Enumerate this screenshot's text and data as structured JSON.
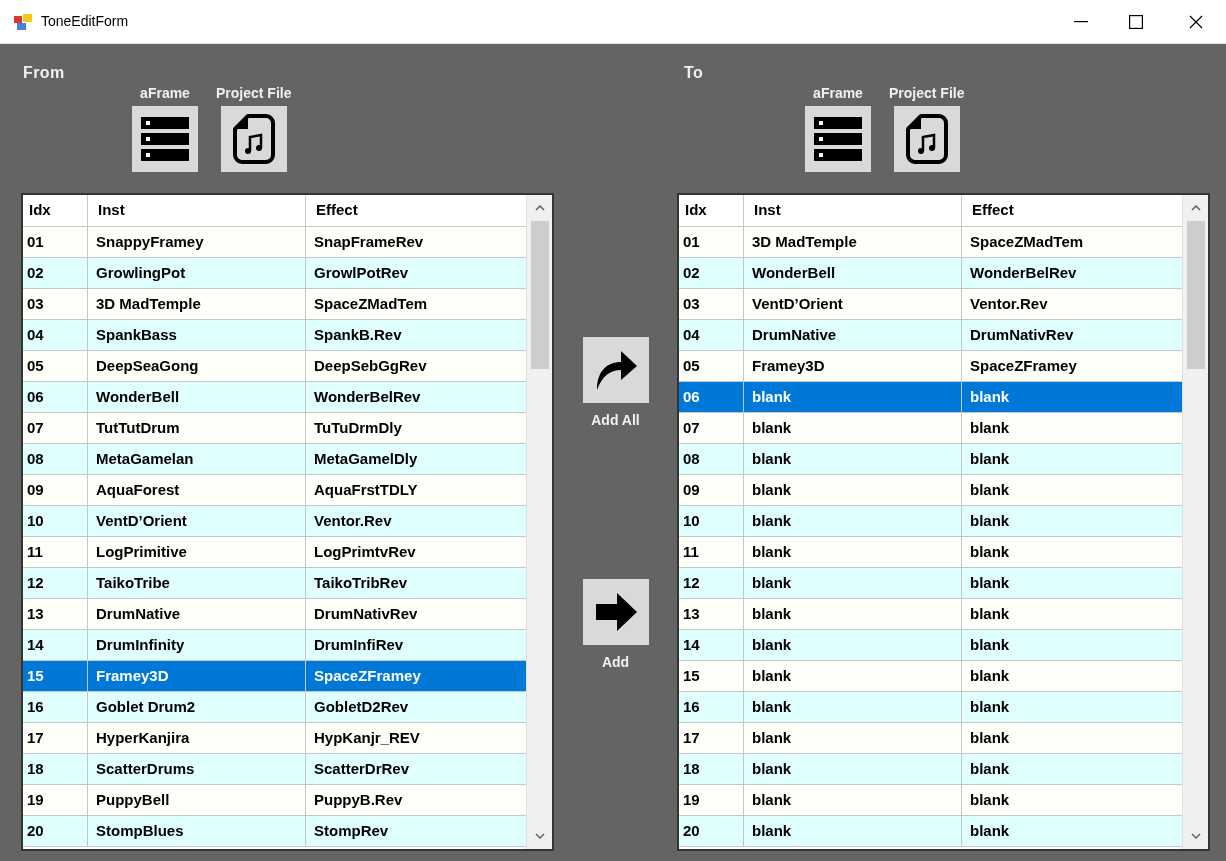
{
  "window": {
    "title": "ToneEditForm"
  },
  "panels": [
    {
      "heading": "From",
      "sources": [
        {
          "label": "aFrame",
          "kind": "frame"
        },
        {
          "label": "Project File",
          "kind": "file"
        }
      ],
      "table": {
        "columns": [
          "Idx",
          "Inst",
          "Effect"
        ],
        "rows": [
          {
            "idx": "01",
            "inst": "SnappyFramey",
            "effect": "SnapFrameRev",
            "selected": false
          },
          {
            "idx": "02",
            "inst": "GrowlingPot",
            "effect": "GrowlPotRev",
            "selected": false
          },
          {
            "idx": "03",
            "inst": "3D MadTemple",
            "effect": "SpaceZMadTem",
            "selected": false
          },
          {
            "idx": "04",
            "inst": "SpankBass",
            "effect": "SpankB.Rev",
            "selected": false
          },
          {
            "idx": "05",
            "inst": "DeepSeaGong",
            "effect": "DeepSebGgRev",
            "selected": false
          },
          {
            "idx": "06",
            "inst": "WonderBell",
            "effect": "WonderBelRev",
            "selected": false
          },
          {
            "idx": "07",
            "inst": "TutTutDrum",
            "effect": "TuTuDrmDly",
            "selected": false
          },
          {
            "idx": "08",
            "inst": "MetaGamelan",
            "effect": "MetaGamelDly",
            "selected": false
          },
          {
            "idx": "09",
            "inst": "AquaForest",
            "effect": "AquaFrstTDLY",
            "selected": false
          },
          {
            "idx": "10",
            "inst": "VentD’Orient",
            "effect": "Ventor.Rev",
            "selected": false
          },
          {
            "idx": "11",
            "inst": "LogPrimitive",
            "effect": "LogPrimtvRev",
            "selected": false
          },
          {
            "idx": "12",
            "inst": "TaikoTribe",
            "effect": "TaikoTribRev",
            "selected": false
          },
          {
            "idx": "13",
            "inst": "DrumNative",
            "effect": "DrumNativRev",
            "selected": false
          },
          {
            "idx": "14",
            "inst": "DrumInfinity",
            "effect": "DrumInfiRev",
            "selected": false
          },
          {
            "idx": "15",
            "inst": "Framey3D",
            "effect": "SpaceZFramey",
            "selected": true
          },
          {
            "idx": "16",
            "inst": "Goblet Drum2",
            "effect": "GobletD2Rev",
            "selected": false
          },
          {
            "idx": "17",
            "inst": "HyperKanjira",
            "effect": "HypKanjr_REV",
            "selected": false
          },
          {
            "idx": "18",
            "inst": "ScatterDrums",
            "effect": "ScatterDrRev",
            "selected": false
          },
          {
            "idx": "19",
            "inst": "PuppyBell",
            "effect": "PuppyB.Rev",
            "selected": false
          },
          {
            "idx": "20",
            "inst": "StompBlues",
            "effect": "StompRev",
            "selected": false
          }
        ]
      }
    },
    {
      "heading": "To",
      "sources": [
        {
          "label": "aFrame",
          "kind": "frame"
        },
        {
          "label": "Project File",
          "kind": "file"
        }
      ],
      "table": {
        "columns": [
          "Idx",
          "Inst",
          "Effect"
        ],
        "rows": [
          {
            "idx": "01",
            "inst": "3D MadTemple",
            "effect": "SpaceZMadTem",
            "selected": false
          },
          {
            "idx": "02",
            "inst": "WonderBell",
            "effect": "WonderBelRev",
            "selected": false
          },
          {
            "idx": "03",
            "inst": "VentD’Orient",
            "effect": "Ventor.Rev",
            "selected": false
          },
          {
            "idx": "04",
            "inst": "DrumNative",
            "effect": "DrumNativRev",
            "selected": false
          },
          {
            "idx": "05",
            "inst": "Framey3D",
            "effect": "SpaceZFramey",
            "selected": false
          },
          {
            "idx": "06",
            "inst": "blank",
            "effect": "blank",
            "selected": true
          },
          {
            "idx": "07",
            "inst": "blank",
            "effect": "blank",
            "selected": false
          },
          {
            "idx": "08",
            "inst": "blank",
            "effect": "blank",
            "selected": false
          },
          {
            "idx": "09",
            "inst": "blank",
            "effect": "blank",
            "selected": false
          },
          {
            "idx": "10",
            "inst": "blank",
            "effect": "blank",
            "selected": false
          },
          {
            "idx": "11",
            "inst": "blank",
            "effect": "blank",
            "selected": false
          },
          {
            "idx": "12",
            "inst": "blank",
            "effect": "blank",
            "selected": false
          },
          {
            "idx": "13",
            "inst": "blank",
            "effect": "blank",
            "selected": false
          },
          {
            "idx": "14",
            "inst": "blank",
            "effect": "blank",
            "selected": false
          },
          {
            "idx": "15",
            "inst": "blank",
            "effect": "blank",
            "selected": false
          },
          {
            "idx": "16",
            "inst": "blank",
            "effect": "blank",
            "selected": false
          },
          {
            "idx": "17",
            "inst": "blank",
            "effect": "blank",
            "selected": false
          },
          {
            "idx": "18",
            "inst": "blank",
            "effect": "blank",
            "selected": false
          },
          {
            "idx": "19",
            "inst": "blank",
            "effect": "blank",
            "selected": false
          },
          {
            "idx": "20",
            "inst": "blank",
            "effect": "blank",
            "selected": false
          }
        ]
      }
    }
  ],
  "actions": [
    {
      "label": "Add All",
      "kind": "all"
    },
    {
      "label": "Add",
      "kind": "single"
    }
  ]
}
